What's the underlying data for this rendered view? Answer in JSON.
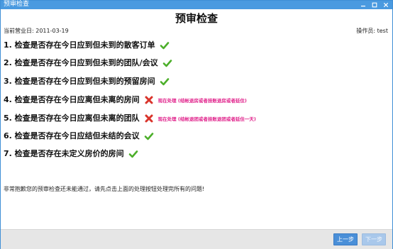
{
  "window": {
    "title": "预审检查",
    "controls": [
      "minimize-icon",
      "maximize-icon",
      "close-icon"
    ]
  },
  "header": {
    "title": "预审检查",
    "business_date": "当前营业日: 2011-03-19",
    "operator": "操作员: test"
  },
  "checks": [
    {
      "text": "1. 检查是否存在今日应到但未到的散客订单",
      "status": "pass",
      "action": ""
    },
    {
      "text": "2. 检查是否存在今日应到但未到的团队/会议",
      "status": "pass",
      "action": ""
    },
    {
      "text": "3. 检查是否存在今日应到但未到的预留房间",
      "status": "pass",
      "action": ""
    },
    {
      "text": "4. 检查是否存在今日应离但未离的房间",
      "status": "fail",
      "action": "现在处理 (结帐退房或者挂账退房或者延住)"
    },
    {
      "text": "5. 检查是否存在今日应离但未离的团队",
      "status": "fail",
      "action": "现在处理 (结帐退团或者挂账退团或者延住一天)"
    },
    {
      "text": "6. 检查是否存在今日应结但未结的会议",
      "status": "pass",
      "action": ""
    },
    {
      "text": "7. 检查是否存在未定义房价的房间",
      "status": "pass",
      "action": ""
    }
  ],
  "message": "非常抱歉您的预审检查还未能通过，请先点击上面的处理按钮处理完所有的问题!",
  "footer": {
    "prev_label": "上一步",
    "next_label": "下一步"
  },
  "colors": {
    "titlebar": "#4a9ae0",
    "pass": "#4caf2a",
    "fail": "#d9342b",
    "action_link": "#e0208a",
    "primary_button": "#4a8fd8",
    "disabled_button": "#a9c8eb"
  }
}
